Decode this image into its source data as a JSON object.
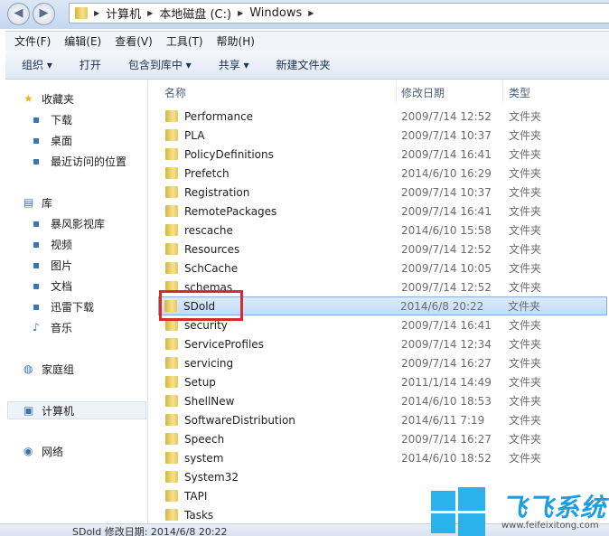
{
  "address": {
    "crumbs": [
      "计算机",
      "本地磁盘 (C:)",
      "Windows"
    ]
  },
  "menu": [
    "文件(F)",
    "编辑(E)",
    "查看(V)",
    "工具(T)",
    "帮助(H)"
  ],
  "toolbar": [
    "组织 ▾",
    "打开",
    "包含到库中 ▾",
    "共享 ▾",
    "新建文件夹"
  ],
  "sidebar": [
    {
      "label": "收藏夹",
      "icon": "star-icon",
      "top": true
    },
    {
      "label": "下载",
      "icon": "download-folder-icon"
    },
    {
      "label": "桌面",
      "icon": "desktop-icon"
    },
    {
      "label": "最近访问的位置",
      "icon": "recent-places-icon"
    },
    {
      "label": "库",
      "icon": "library-icon",
      "top": true
    },
    {
      "label": "暴风影视库",
      "icon": "video-library-icon"
    },
    {
      "label": "视频",
      "icon": "video-icon"
    },
    {
      "label": "图片",
      "icon": "picture-icon"
    },
    {
      "label": "文档",
      "icon": "document-icon"
    },
    {
      "label": "迅雷下载",
      "icon": "download-icon"
    },
    {
      "label": "音乐",
      "icon": "music-icon"
    },
    {
      "label": "家庭组",
      "icon": "homegroup-icon",
      "top": true
    },
    {
      "label": "计算机",
      "icon": "computer-icon",
      "top": true,
      "selected": true
    },
    {
      "label": "网络",
      "icon": "network-icon",
      "top": true
    }
  ],
  "columns": {
    "name": "名称",
    "date": "修改日期",
    "type": "类型"
  },
  "files": [
    {
      "name": "Performance",
      "date": "2009/7/14 12:52",
      "type": "文件夹"
    },
    {
      "name": "PLA",
      "date": "2009/7/14 10:37",
      "type": "文件夹"
    },
    {
      "name": "PolicyDefinitions",
      "date": "2009/7/14 16:41",
      "type": "文件夹"
    },
    {
      "name": "Prefetch",
      "date": "2014/6/10 16:29",
      "type": "文件夹"
    },
    {
      "name": "Registration",
      "date": "2009/7/14 10:37",
      "type": "文件夹"
    },
    {
      "name": "RemotePackages",
      "date": "2009/7/14 16:41",
      "type": "文件夹"
    },
    {
      "name": "rescache",
      "date": "2014/6/10 15:58",
      "type": "文件夹"
    },
    {
      "name": "Resources",
      "date": "2009/7/14 12:52",
      "type": "文件夹"
    },
    {
      "name": "SchCache",
      "date": "2009/7/14 10:05",
      "type": "文件夹"
    },
    {
      "name": "schemas",
      "date": "2009/7/14 12:52",
      "type": "文件夹"
    },
    {
      "name": "SDold",
      "date": "2014/6/8 20:22",
      "type": "文件夹",
      "selected": true
    },
    {
      "name": "security",
      "date": "2009/7/14 16:41",
      "type": "文件夹"
    },
    {
      "name": "ServiceProfiles",
      "date": "2009/7/14 12:34",
      "type": "文件夹"
    },
    {
      "name": "servicing",
      "date": "2009/7/14 16:27",
      "type": "文件夹"
    },
    {
      "name": "Setup",
      "date": "2011/1/14 14:49",
      "type": "文件夹"
    },
    {
      "name": "ShellNew",
      "date": "2014/6/10 18:53",
      "type": "文件夹"
    },
    {
      "name": "SoftwareDistribution",
      "date": "2014/6/11 7:19",
      "type": "文件夹"
    },
    {
      "name": "Speech",
      "date": "2009/7/14 16:27",
      "type": "文件夹"
    },
    {
      "name": "system",
      "date": "2014/6/10 18:52",
      "type": "文件夹"
    },
    {
      "name": "System32",
      "date": "",
      "type": ""
    },
    {
      "name": "TAPI",
      "date": "",
      "type": ""
    },
    {
      "name": "Tasks",
      "date": "",
      "type": ""
    }
  ],
  "status": "SDold  修改日期: 2014/6/8 20:22",
  "watermark": {
    "text": "飞飞系统",
    "url": "www.feifeixitong.com",
    "color": "#2ab2ec"
  }
}
